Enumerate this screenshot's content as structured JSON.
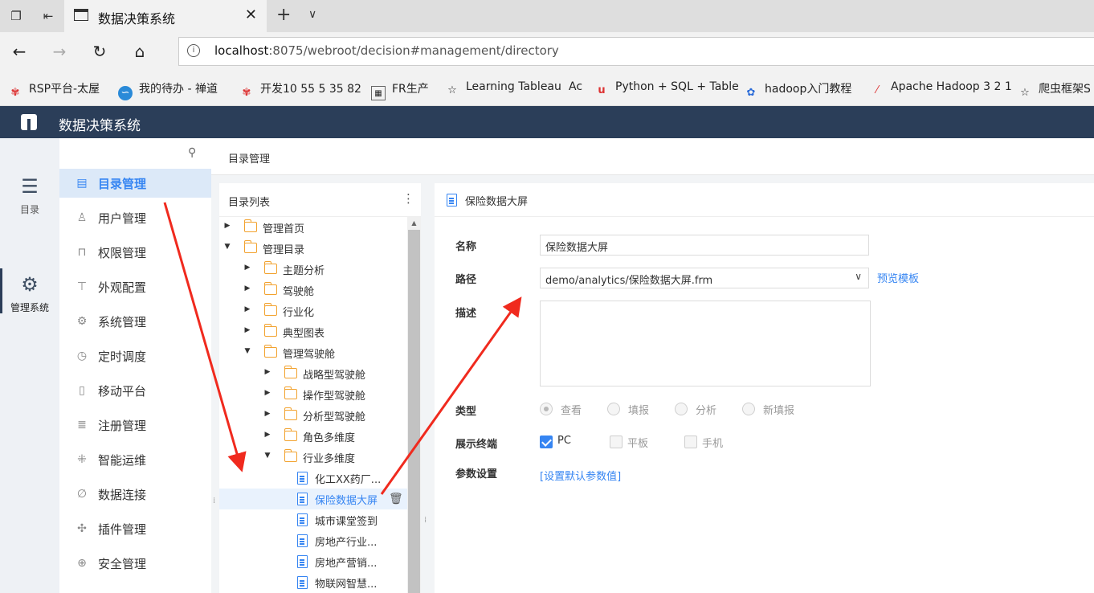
{
  "browser": {
    "tab_title": "数据决策系统",
    "url_host": "localhost",
    "url_rest": ":8075/webroot/decision#management/directory",
    "bookmarks": [
      "RSP平台-太屋",
      "我的待办 - 禅道",
      "开发10 55 5 35 82",
      "FR生产",
      "Learning Tableau",
      "Ac",
      "Python + SQL + Table",
      "hadoop入门教程",
      "Apache Hadoop 3 2 1",
      "爬虫框架S"
    ]
  },
  "app": {
    "title": "数据决策系统"
  },
  "rail": {
    "items": [
      {
        "label": "目录",
        "icon": "list-icon",
        "active": false
      },
      {
        "label": "管理系统",
        "icon": "gear-icon",
        "active": true
      }
    ]
  },
  "menu": {
    "items": [
      {
        "label": "目录管理",
        "icon": "directory-icon",
        "active": true
      },
      {
        "label": "用户管理",
        "icon": "user-icon"
      },
      {
        "label": "权限管理",
        "icon": "lock-icon"
      },
      {
        "label": "外观配置",
        "icon": "paint-roller-icon"
      },
      {
        "label": "系统管理",
        "icon": "gear-icon"
      },
      {
        "label": "定时调度",
        "icon": "timer-icon"
      },
      {
        "label": "移动平台",
        "icon": "mobile-icon"
      },
      {
        "label": "注册管理",
        "icon": "register-icon"
      },
      {
        "label": "智能运维",
        "icon": "network-icon"
      },
      {
        "label": "数据连接",
        "icon": "link-icon"
      },
      {
        "label": "插件管理",
        "icon": "puzzle-icon"
      },
      {
        "label": "安全管理",
        "icon": "shield-icon"
      }
    ]
  },
  "breadcrumb": "目录管理",
  "tree": {
    "title": "目录列表",
    "rows": [
      {
        "label": "管理首页",
        "type": "folder",
        "level": 0,
        "arrow": "right"
      },
      {
        "label": "管理目录",
        "type": "folder",
        "level": 0,
        "arrow": "down"
      },
      {
        "label": "主题分析",
        "type": "folder",
        "level": 1,
        "arrow": "right"
      },
      {
        "label": "驾驶舱",
        "type": "folder",
        "level": 1,
        "arrow": "right"
      },
      {
        "label": "行业化",
        "type": "folder",
        "level": 1,
        "arrow": "right"
      },
      {
        "label": "典型图表",
        "type": "folder",
        "level": 1,
        "arrow": "right"
      },
      {
        "label": "管理驾驶舱",
        "type": "folder",
        "level": 1,
        "arrow": "down"
      },
      {
        "label": "战略型驾驶舱",
        "type": "folder",
        "level": 2,
        "arrow": "right"
      },
      {
        "label": "操作型驾驶舱",
        "type": "folder",
        "level": 2,
        "arrow": "right"
      },
      {
        "label": "分析型驾驶舱",
        "type": "folder",
        "level": 2,
        "arrow": "right"
      },
      {
        "label": "角色多维度",
        "type": "folder",
        "level": 2,
        "arrow": "right"
      },
      {
        "label": "行业多维度",
        "type": "folder",
        "level": 2,
        "arrow": "down"
      },
      {
        "label": "化工XX药厂...",
        "type": "file",
        "level": 3
      },
      {
        "label": "保险数据大屏",
        "type": "file",
        "level": 3,
        "selected": true
      },
      {
        "label": "城市课堂签到",
        "type": "file",
        "level": 3
      },
      {
        "label": "房地产行业...",
        "type": "file",
        "level": 3
      },
      {
        "label": "房地产营销...",
        "type": "file",
        "level": 3
      },
      {
        "label": "物联网智慧...",
        "type": "file",
        "level": 3
      }
    ]
  },
  "detail": {
    "title": "保险数据大屏",
    "name_label": "名称",
    "name_value": "保险数据大屏",
    "path_label": "路径",
    "path_value": "demo/analytics/保险数据大屏.frm",
    "preview_label": "预览模板",
    "desc_label": "描述",
    "type_label": "类型",
    "type_options": [
      {
        "label": "查看",
        "checked": true
      },
      {
        "label": "填报",
        "checked": false
      },
      {
        "label": "分析",
        "checked": false
      },
      {
        "label": "新填报",
        "checked": false
      }
    ],
    "terminal_label": "展示终端",
    "terminal_options": [
      {
        "label": "PC",
        "checked": true
      },
      {
        "label": "平板",
        "checked": false
      },
      {
        "label": "手机",
        "checked": false
      }
    ],
    "param_label": "参数设置",
    "param_link": "[设置默认参数值]"
  },
  "colors": {
    "header_bg": "#2b3e59",
    "accent": "#3685f2",
    "folder": "#f2a22e",
    "annotation_arrow": "#f02a1e"
  }
}
